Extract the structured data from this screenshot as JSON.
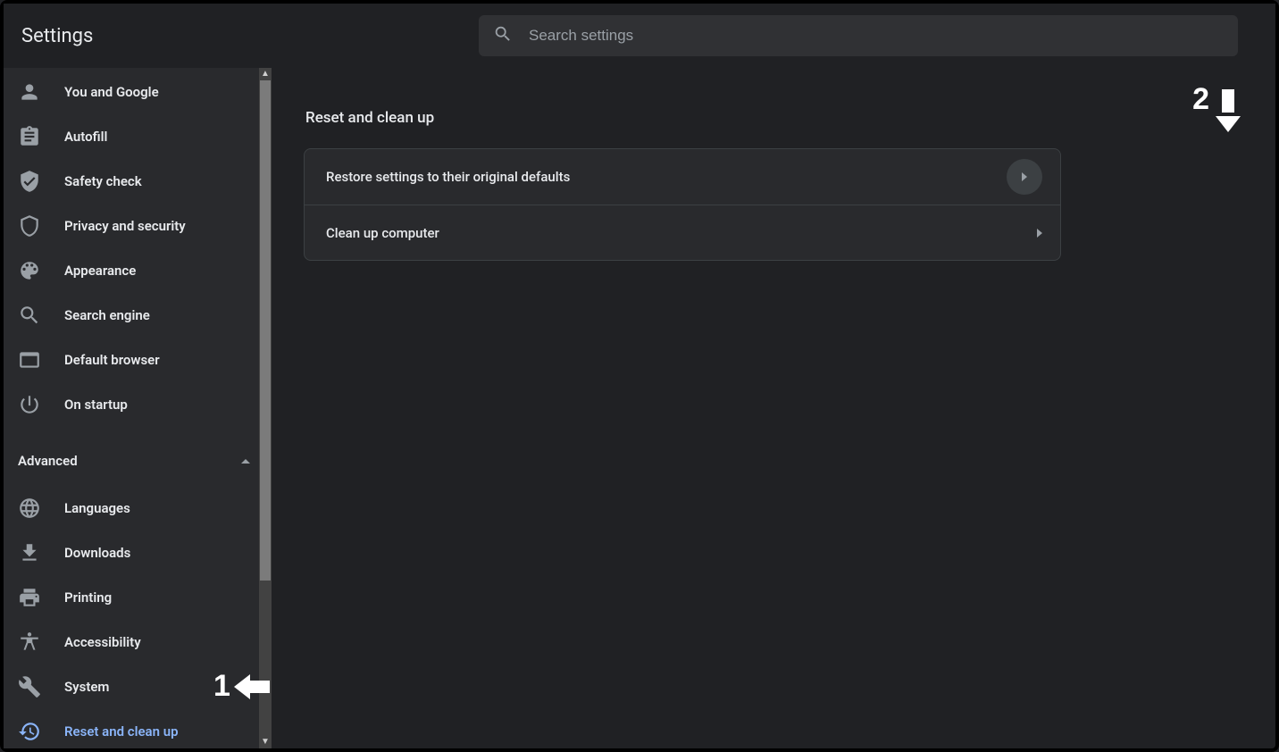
{
  "header": {
    "title": "Settings",
    "search_placeholder": "Search settings"
  },
  "sidebar": {
    "items_basic": [
      {
        "id": "you-and-google",
        "label": "You and Google"
      },
      {
        "id": "autofill",
        "label": "Autofill"
      },
      {
        "id": "safety-check",
        "label": "Safety check"
      },
      {
        "id": "privacy-security",
        "label": "Privacy and security"
      },
      {
        "id": "appearance",
        "label": "Appearance"
      },
      {
        "id": "search-engine",
        "label": "Search engine"
      },
      {
        "id": "default-browser",
        "label": "Default browser"
      },
      {
        "id": "on-startup",
        "label": "On startup"
      }
    ],
    "advanced_label": "Advanced",
    "items_advanced": [
      {
        "id": "languages",
        "label": "Languages"
      },
      {
        "id": "downloads",
        "label": "Downloads"
      },
      {
        "id": "printing",
        "label": "Printing"
      },
      {
        "id": "accessibility",
        "label": "Accessibility"
      },
      {
        "id": "system",
        "label": "System"
      },
      {
        "id": "reset-cleanup",
        "label": "Reset and clean up"
      }
    ]
  },
  "main": {
    "section_title": "Reset and clean up",
    "rows": [
      {
        "id": "restore-defaults",
        "label": "Restore settings to their original defaults"
      },
      {
        "id": "clean-up-computer",
        "label": "Clean up computer"
      }
    ]
  },
  "annotations": {
    "one": "1",
    "two": "2"
  }
}
